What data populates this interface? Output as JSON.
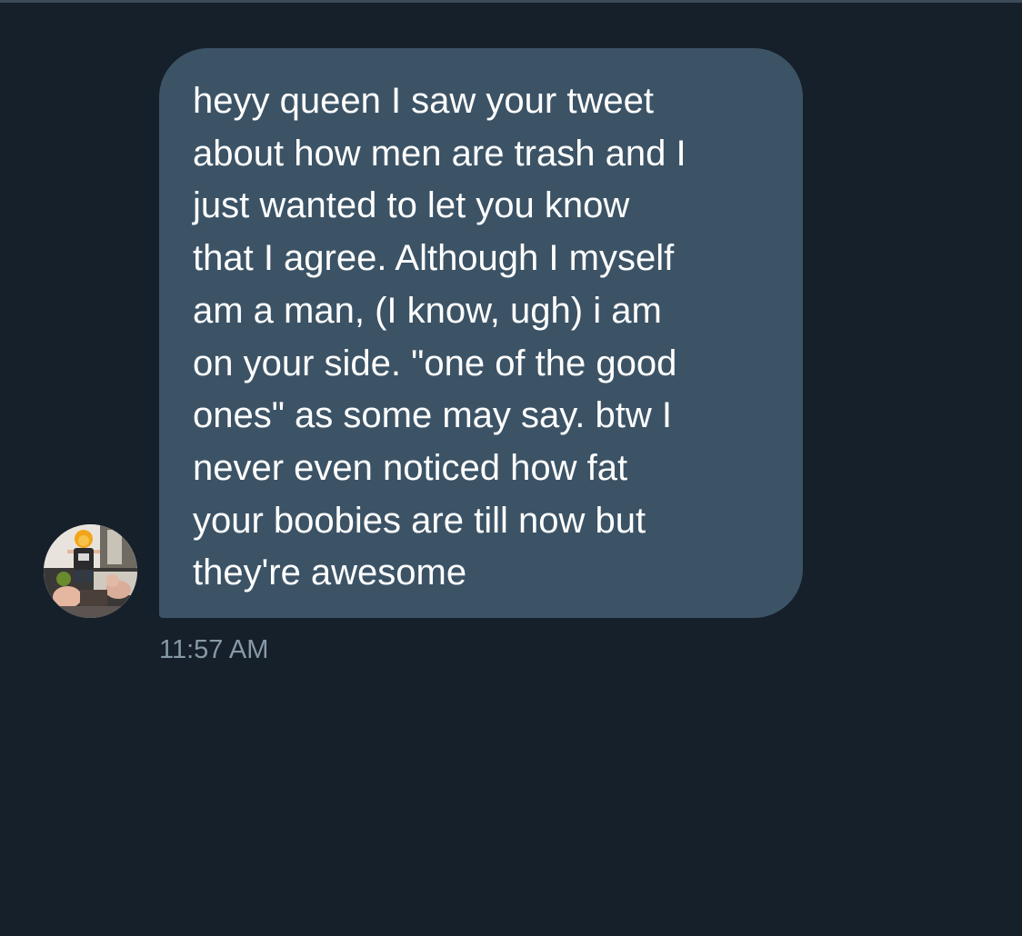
{
  "conversation": {
    "message": {
      "text": "heyy queen I saw your tweet\nabout how men are trash and I\njust wanted to let you know\nthat I agree. Although I myself\nam a man, (I know, ugh) i am\non your side. \"one of the good\nones\" as some may say. btw I\nnever even noticed how fat\nyour boobies are till now but\nthey're awesome",
      "timestamp": "11:57 AM",
      "sender_avatar": "profile-photo"
    }
  },
  "colors": {
    "background": "#15202b",
    "bubble": "#3c5366",
    "message_text": "#ffffff",
    "timestamp": "#8899a6",
    "divider": "#3d4a57"
  }
}
